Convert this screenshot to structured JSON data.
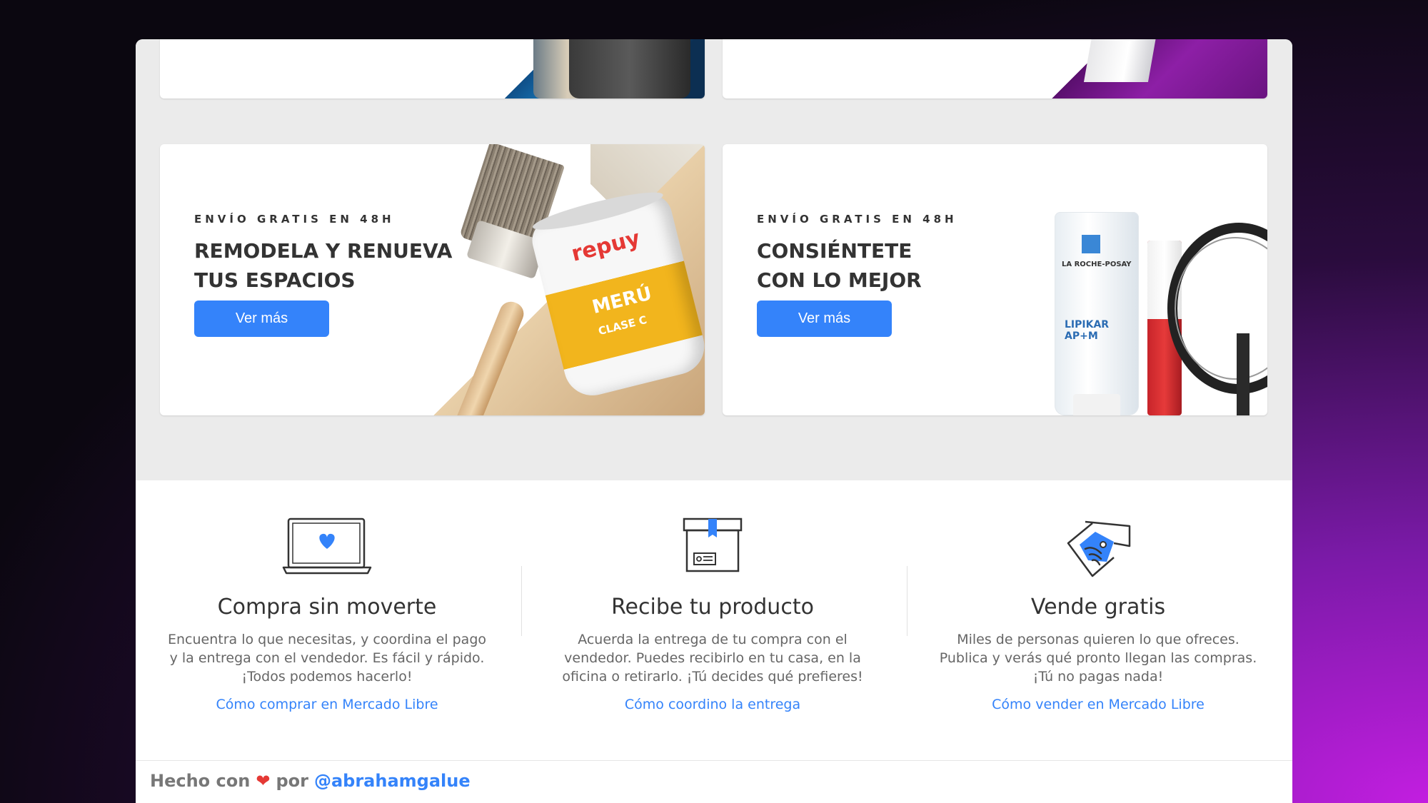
{
  "banners": {
    "top_left": {
      "decor": "phones-banner"
    },
    "top_right": {
      "decor": "console-banner"
    },
    "card_left": {
      "eyebrow": "ENVÍO GRATIS EN 48H",
      "headline": "REMODELA Y RENUEVA\nTUS ESPACIOS",
      "button": "Ver más",
      "product": {
        "brand": "repuy",
        "name": "MERÚ",
        "class": "CLASE C"
      }
    },
    "card_right": {
      "eyebrow": "ENVÍO GRATIS EN 48H",
      "headline": "CONSIÉNTETE\nCON LO MEJOR",
      "button": "Ver más",
      "product": {
        "brand": "LA ROCHE-POSAY",
        "name": "LIPIKAR AP+M"
      }
    }
  },
  "features": [
    {
      "icon": "laptop-heart-icon",
      "title": "Compra sin moverte",
      "description": "Encuentra lo que necesitas, y coordina el pago y la entrega con el vendedor. Es fácil y rápido. ¡Todos podemos hacerlo!",
      "link": "Cómo comprar en Mercado Libre"
    },
    {
      "icon": "package-icon",
      "title": "Recibe tu producto",
      "description": "Acuerda la entrega de tu compra con el vendedor. Puedes recibirlo en tu casa, en la oficina o retirarlo. ¡Tú decides qué prefieres!",
      "link": "Cómo coordino la entrega"
    },
    {
      "icon": "handshake-icon",
      "title": "Vende gratis",
      "description": "Miles de personas quieren lo que ofreces. Publica y verás qué pronto llegan las compras. ¡Tú no pagas nada!",
      "link": "Cómo vender en Mercado Libre"
    }
  ],
  "footer": {
    "made_with": "Hecho con",
    "heart_icon": "heart-icon",
    "by": "por",
    "author": "@abrahamgalue"
  },
  "colors": {
    "accent": "#3483fa",
    "heart": "#e53935",
    "text": "#333333",
    "muted": "#666666"
  }
}
